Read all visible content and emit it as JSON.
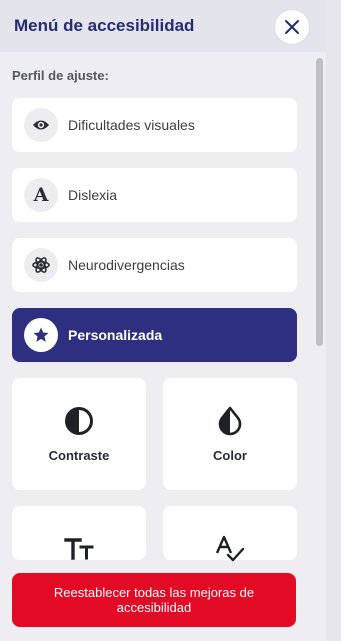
{
  "header": {
    "title": "Menú de accesibilidad"
  },
  "section": {
    "label": "Perfil de ajuste:"
  },
  "profiles": [
    {
      "label": "Dificultades visuales",
      "icon": "eye-icon"
    },
    {
      "label": "Dislexia",
      "icon": "letter-a-icon"
    },
    {
      "label": "Neurodivergencias",
      "icon": "atom-icon"
    },
    {
      "label": "Personalizada",
      "icon": "star-icon",
      "active": true
    }
  ],
  "cards": [
    {
      "label": "Contraste",
      "icon": "contrast-icon"
    },
    {
      "label": "Color",
      "icon": "drop-icon"
    },
    {
      "label": "",
      "icon": "text-size-icon"
    },
    {
      "label": "",
      "icon": "spell-check-icon"
    }
  ],
  "footer": {
    "reset_label": "Reestablecer todas las mejoras de accesibilidad"
  },
  "colors": {
    "accent": "#2e2f80",
    "title": "#262b73",
    "danger": "#e30a26"
  }
}
